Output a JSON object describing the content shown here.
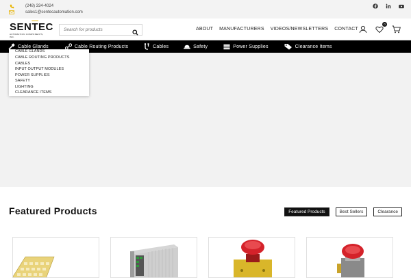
{
  "topbar": {
    "phone": "(248) 334-4024",
    "email": "sales1@sentecautomation.com",
    "social_icons": [
      "facebook-icon",
      "linkedin-icon",
      "youtube-icon"
    ]
  },
  "logo": {
    "text_a": "SEN",
    "text_b": "T",
    "text_c": "EC",
    "tagline": "AUTOMATION COMPONENTS, INC."
  },
  "search": {
    "placeholder": "Search for products"
  },
  "nav": {
    "items": [
      "ABOUT",
      "MANUFACTURERS",
      "VIDEOS/NEWSLETTERS",
      "CONTACT"
    ]
  },
  "wishlist": {
    "count": "0"
  },
  "categories": [
    {
      "label": "Cable Glands",
      "icon": "cable-gland-icon"
    },
    {
      "label": "Cable Routing Products",
      "icon": "cable-routing-icon"
    },
    {
      "label": "Cables",
      "icon": "cables-icon"
    },
    {
      "label": "Safety",
      "icon": "safety-icon"
    },
    {
      "label": "Power Supplies",
      "icon": "power-supply-icon"
    },
    {
      "label": "Clearance Items",
      "icon": "tag-icon"
    }
  ],
  "dropdown": {
    "items": [
      "CABLE GLANDS",
      "CABLE ROUTING PRODUCTS",
      "CABLES",
      "INPUT OUTPUT MODULES",
      "POWER SUPPLIES",
      "SAFETY",
      "LIGHTING",
      "CLEARANCE ITEMS"
    ]
  },
  "featured": {
    "title": "Featured Products",
    "tabs": [
      "Featured Products",
      "Best Sellers",
      "Clearance"
    ],
    "active_tab": "Featured Products"
  },
  "colors": {
    "accent": "#f2c100",
    "bar": "#000000",
    "hero": "#f2f2f2"
  }
}
